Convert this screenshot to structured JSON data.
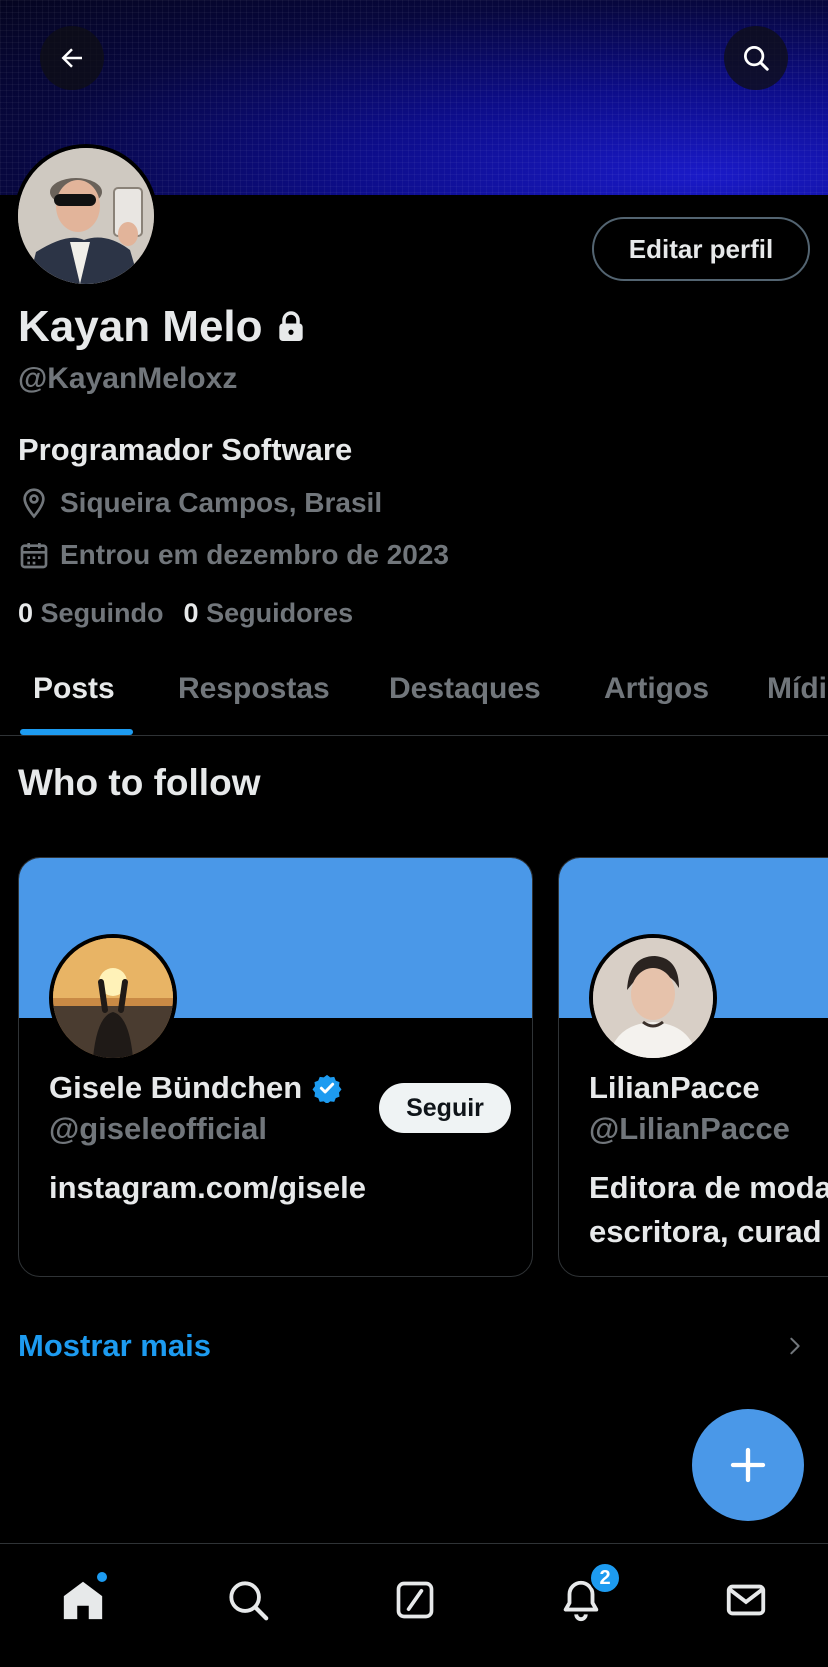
{
  "header": {
    "back_icon": "arrow-left-icon",
    "search_icon": "search-icon"
  },
  "profile": {
    "name": "Kayan Melo",
    "handle": "@KayanMeloxz",
    "bio": "Programador Software",
    "location": "Siqueira Campos, Brasil",
    "joined": "Entrou em dezembro de 2023",
    "following_count": "0",
    "following_label": "Seguindo",
    "followers_count": "0",
    "followers_label": "Seguidores",
    "edit_button": "Editar perfil"
  },
  "tabs": [
    {
      "label": "Posts",
      "active": true
    },
    {
      "label": "Respostas"
    },
    {
      "label": "Destaques"
    },
    {
      "label": "Artigos"
    },
    {
      "label": "Mídi"
    }
  ],
  "who_to_follow": {
    "title": "Who to follow",
    "cards": [
      {
        "name": "Gisele Bündchen",
        "handle": "@giseleofficial",
        "verified": true,
        "description": "instagram.com/gisele",
        "follow_label": "Seguir"
      },
      {
        "name": "LilianPacce",
        "handle": "@LilianPacce",
        "description_line1": "Editora de moda",
        "description_line2": "escritora, curad"
      }
    ],
    "show_more": "Mostrar mais"
  },
  "bottom_nav": {
    "items": [
      "home-icon",
      "search-icon",
      "grok-icon",
      "bell-icon",
      "mail-icon"
    ],
    "notifications_badge": "2"
  },
  "colors": {
    "accent": "#1d9bf0",
    "card_banner": "#4a98e8",
    "fab": "#4a98e8"
  }
}
